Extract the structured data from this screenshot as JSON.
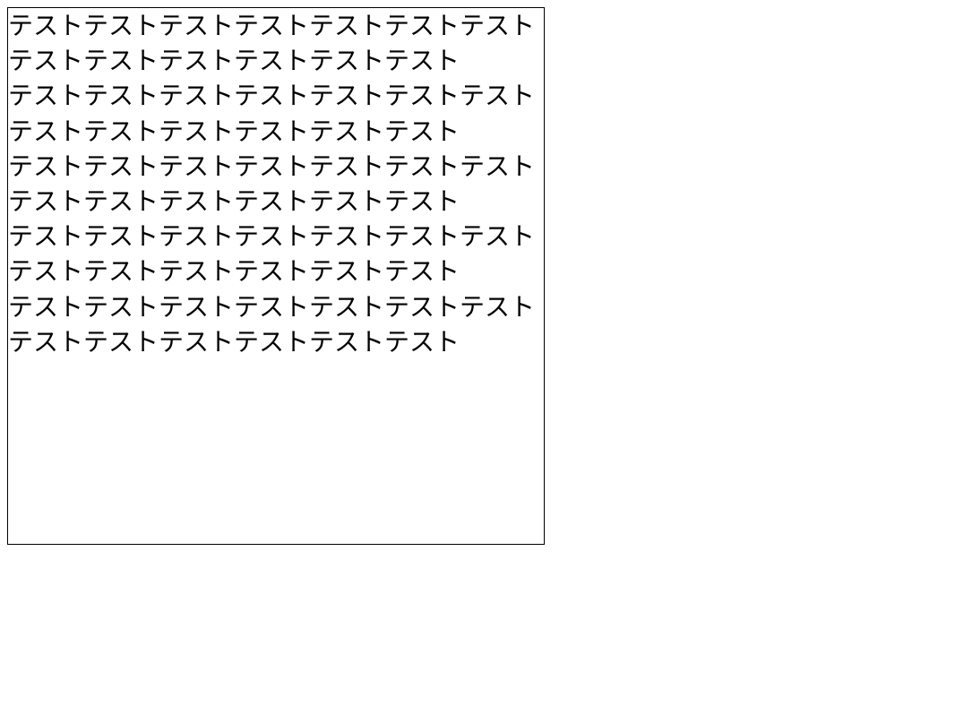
{
  "textbox": {
    "paragraphs": [
      "テストテストテストテストテストテストテストテストテストテストテストテストテスト",
      "テストテストテストテストテストテストテストテストテストテストテストテストテスト",
      "テストテストテストテストテストテストテストテストテストテストテストテストテスト",
      "テストテストテストテストテストテストテストテストテストテストテストテストテスト",
      "テストテストテストテストテストテストテストテストテストテストテストテストテスト"
    ]
  }
}
